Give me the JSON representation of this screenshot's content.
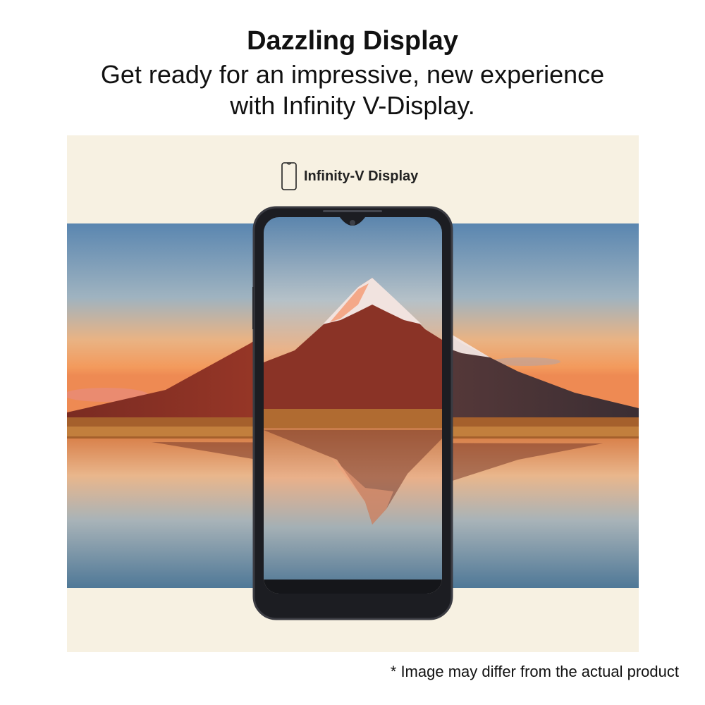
{
  "header": {
    "title": "Dazzling Display",
    "subtitle_line1": "Get ready for an impressive, new experience",
    "subtitle_line2": "with Infinity V-Display."
  },
  "badge": {
    "icon": "phone-outline-icon",
    "label": "Infinity-V Display"
  },
  "footer": {
    "disclaimer": "* Image may differ from the actual product"
  },
  "colors": {
    "panel_background": "#f7f1e2",
    "phone_frame": "#1c1d22",
    "sky_top": "#5f88b0",
    "sky_horizon": "#f0a56a",
    "water": "#6f8ea6"
  }
}
